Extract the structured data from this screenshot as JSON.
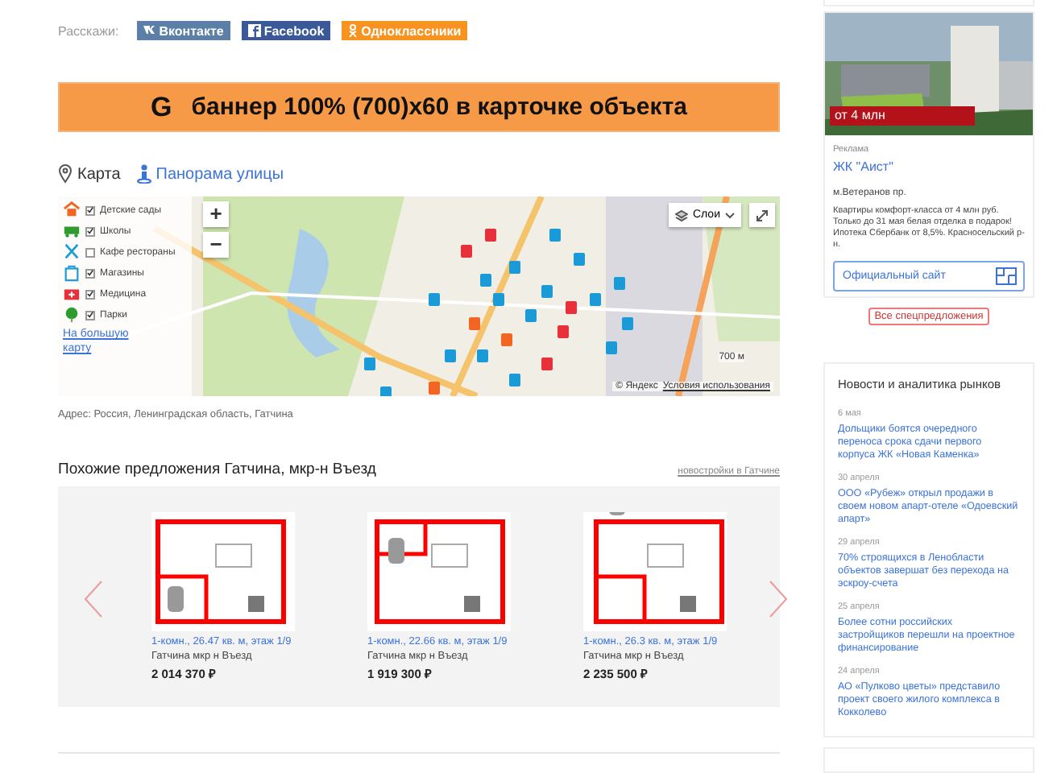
{
  "share": {
    "label": "Расскажи:",
    "buttons": [
      {
        "kind": "vk",
        "label": "Вконтакте"
      },
      {
        "kind": "fb",
        "label": "Facebook"
      },
      {
        "kind": "ok",
        "label": "Одноклассники"
      }
    ]
  },
  "banner": {
    "letter": "G",
    "text": "баннер 100% (700)х60 в карточке объекта"
  },
  "map_tabs": [
    {
      "kind": "map",
      "label": "Карта",
      "selected": true
    },
    {
      "kind": "panorama",
      "label": "Панорама улицы",
      "selected": false
    }
  ],
  "map": {
    "legend": [
      {
        "kind": "kindergarten",
        "label": "Детские сады",
        "checked": true
      },
      {
        "kind": "school",
        "label": "Школы",
        "checked": true
      },
      {
        "kind": "cafe",
        "label": "Кафе рестораны",
        "checked": false
      },
      {
        "kind": "shop",
        "label": "Магазины",
        "checked": true
      },
      {
        "kind": "medicine",
        "label": "Медицина",
        "checked": true
      },
      {
        "kind": "park",
        "label": "Парки",
        "checked": true
      }
    ],
    "big_map_link": "На большую карту",
    "zoom_in": "+",
    "zoom_out": "−",
    "layers": "Слои",
    "scale": "700 м",
    "copyright": "© Яндекс",
    "terms": "Условия использования"
  },
  "address": "Адрес: Россия, Ленинградская область, Гатчина",
  "similar": {
    "title": "Похожие предложения Гатчина, мкр-н Въезд",
    "link": "новостройки в Гатчине",
    "items": [
      {
        "title": "1-комн., 26.47 кв. м, этаж 1/9",
        "location": "Гатчина мкр н Въезд",
        "price": "2 014 370 ₽"
      },
      {
        "title": "1-комн., 22.66 кв. м, этаж 1/9",
        "location": "Гатчина мкр н Въезд",
        "price": "1 919 300 ₽"
      },
      {
        "title": "1-комн., 26.3 кв. м, этаж 1/9",
        "location": "Гатчина мкр н Въезд",
        "price": "2 235 500 ₽"
      }
    ]
  },
  "ad": {
    "badge": "от 4 млн",
    "label": "Реклама",
    "name": "ЖК \"Аист\"",
    "metro": "м.Ветеранов пр.",
    "text": "Квартиры комфорт-класса от 4 млн руб. Только до 31 мая белая отделка в подарок! Ипотека Сбербанк от 8,5%. Красносельский р-н.",
    "button": "Официальный сайт",
    "all_offers": "Все спецпредложения"
  },
  "news": {
    "title": "Новости и аналитика рынков",
    "items": [
      {
        "date": "6 мая",
        "text": "Дольщики боятся очередного переноса срока сдачи первого корпуса ЖК «Новая Каменка»"
      },
      {
        "date": "30 апреля",
        "text": "ООО «Рубеж» открыл продажи в своем новом апарт-отеле «Одоевский апарт»"
      },
      {
        "date": "29 апреля",
        "text": "70% строящихся в Ленобласти объектов завершат без перехода на эскроу-счета"
      },
      {
        "date": "25 апреля",
        "text": "Более сотни российских застройщиков перешли на проектное финансирование"
      },
      {
        "date": "24 апреля",
        "text": "АО «Пулково цветы» представило проект своего жилого комплекса в Кокколево"
      }
    ]
  }
}
